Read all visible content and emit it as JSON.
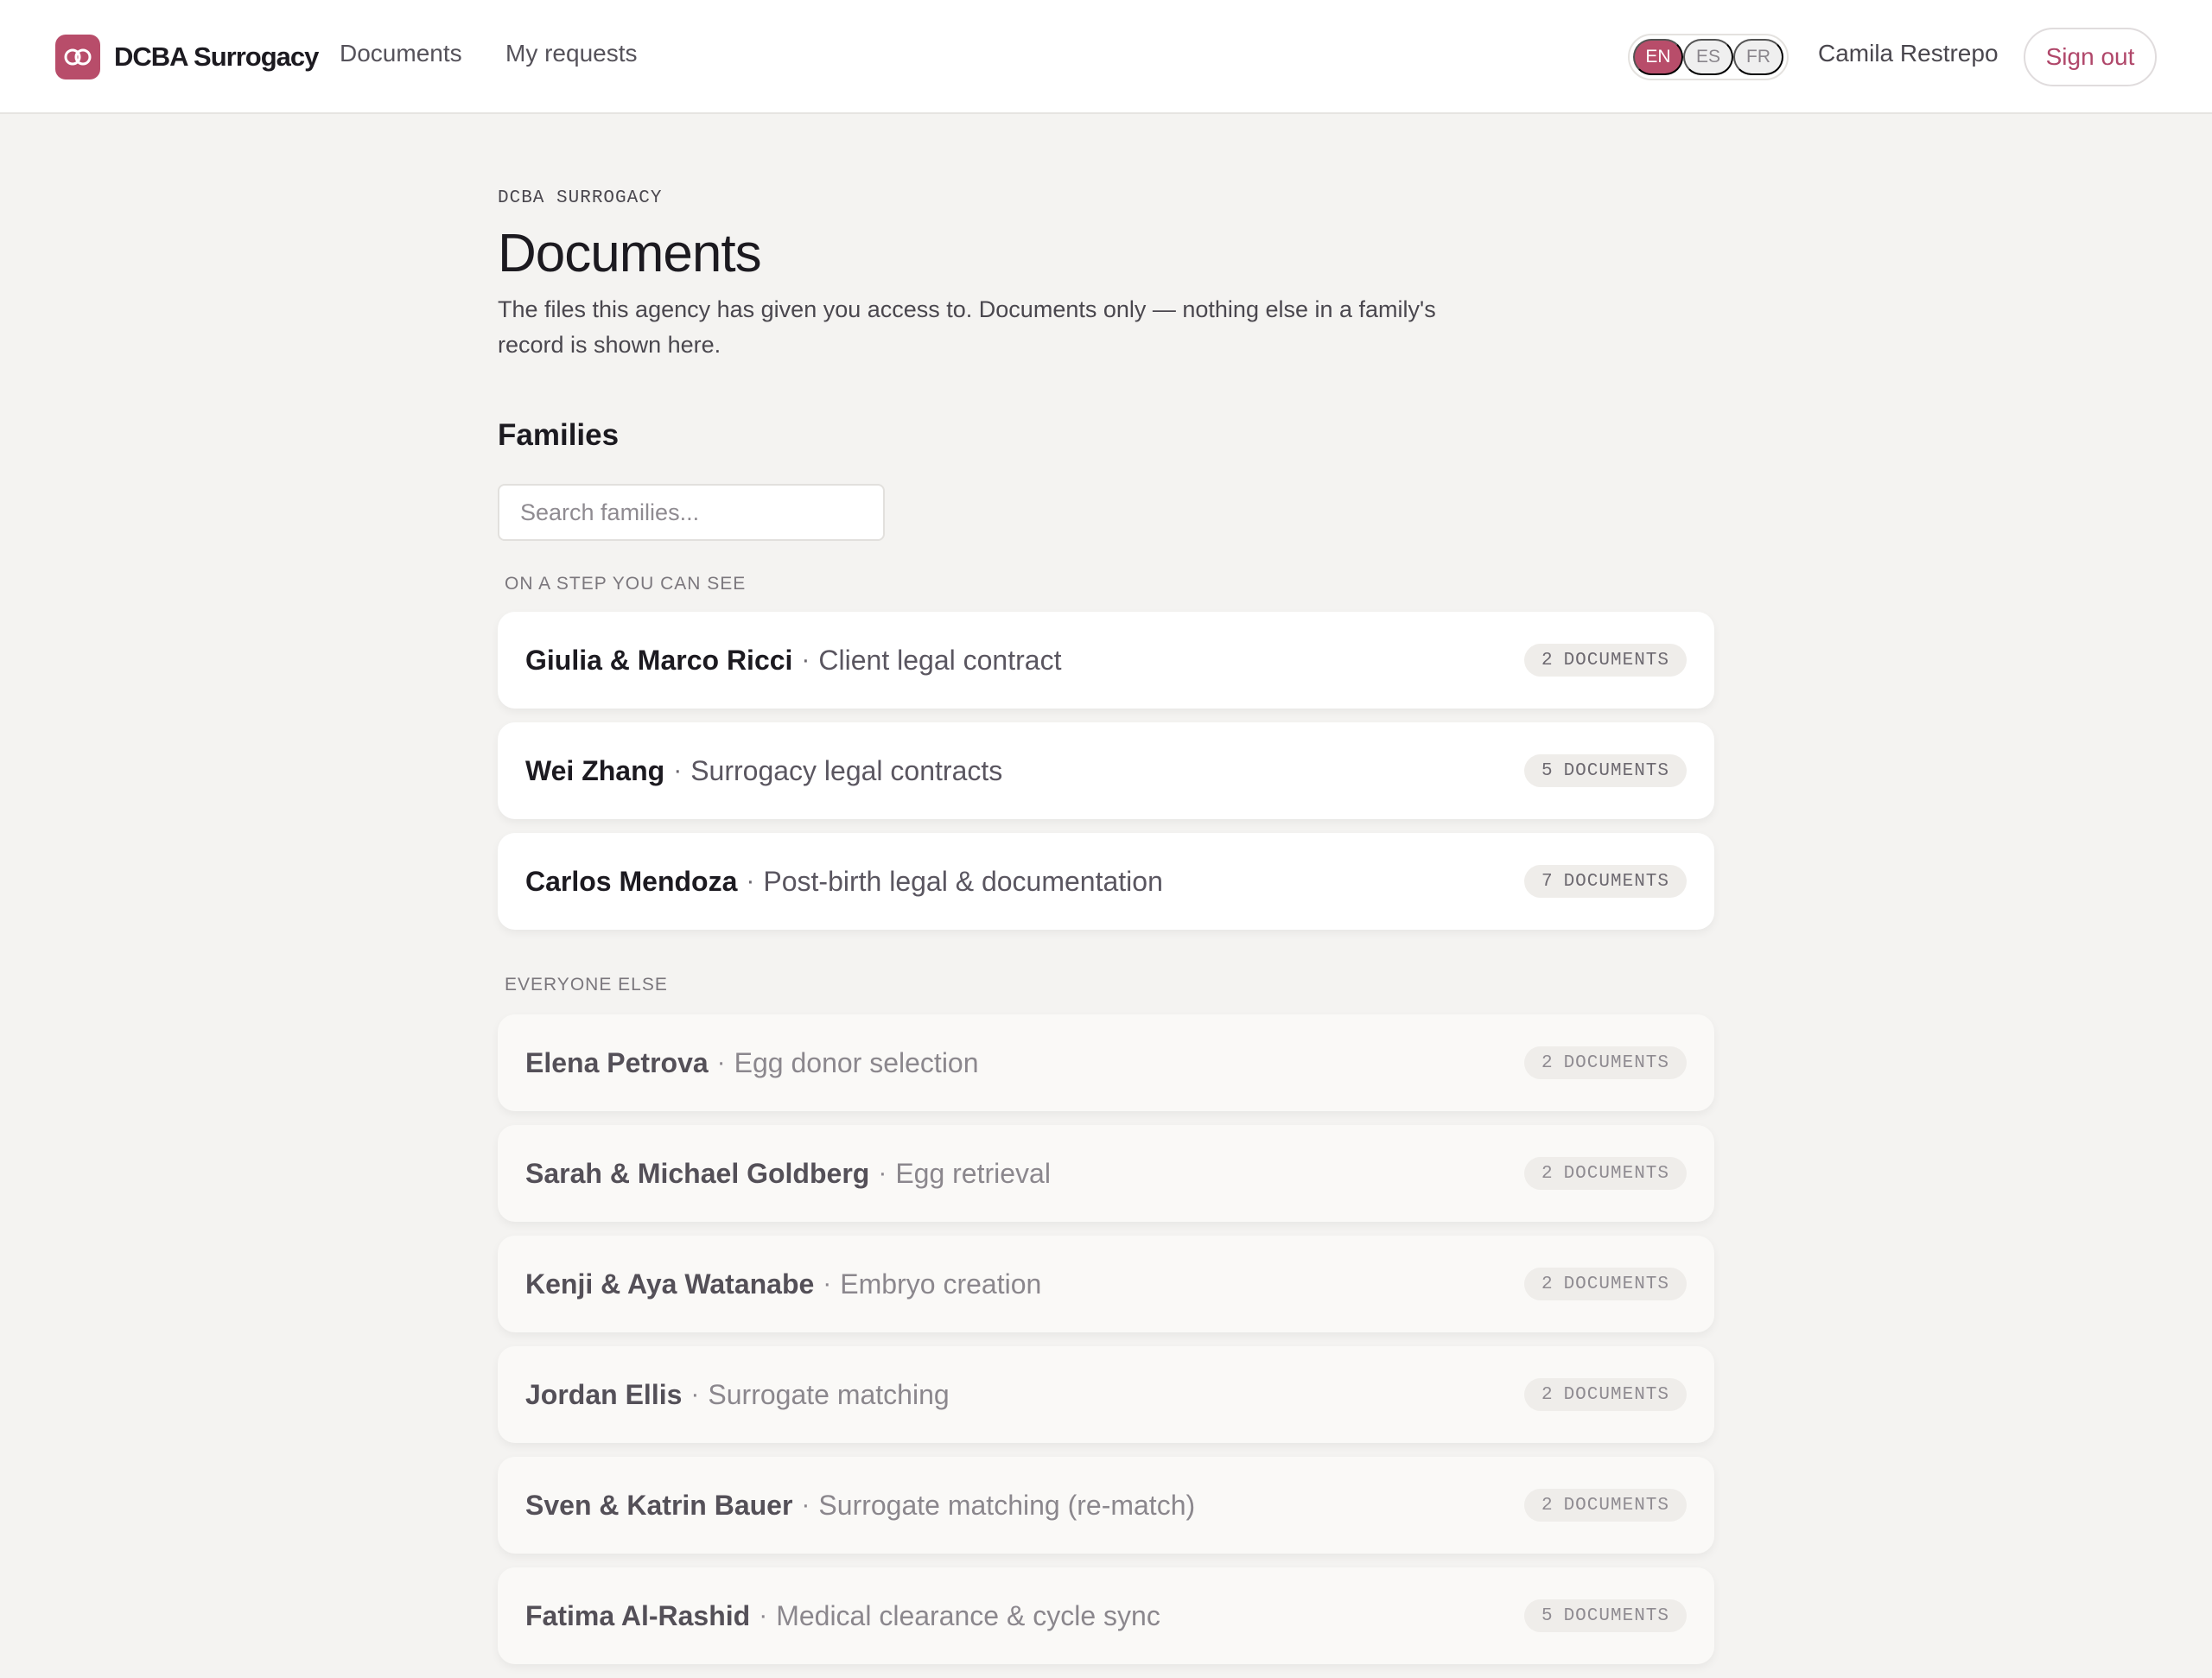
{
  "colors": {
    "accent": "#b84d6a",
    "background": "#f4f3f1",
    "card": "#ffffff",
    "card_muted": "#faf9f7"
  },
  "header": {
    "brand_name": "DCBA Surrogacy",
    "logo_icon": "interlocking-rings-icon",
    "nav": [
      {
        "label": "Documents"
      },
      {
        "label": "My requests"
      }
    ],
    "languages": [
      {
        "code": "EN",
        "active": true
      },
      {
        "code": "ES",
        "active": false
      },
      {
        "code": "FR",
        "active": false
      }
    ],
    "user_name": "Camila Restrepo",
    "sign_out": "Sign out"
  },
  "main": {
    "eyebrow": "DCBA SURROGACY",
    "title": "Documents",
    "description": "The files this agency has given you access to. Documents only — nothing else in a family's record is shown here.",
    "section_title": "Families",
    "search_placeholder": "Search families...",
    "groups": [
      {
        "label": "ON A STEP YOU CAN SEE",
        "families": [
          {
            "name": "Giulia & Marco Ricci",
            "step": "Client legal contract",
            "count": "2",
            "unit": "DOCUMENTS"
          },
          {
            "name": "Wei Zhang",
            "step": "Surrogacy legal contracts",
            "count": "5",
            "unit": "DOCUMENTS"
          },
          {
            "name": "Carlos Mendoza",
            "step": "Post-birth legal & documentation",
            "count": "7",
            "unit": "DOCUMENTS"
          }
        ]
      },
      {
        "label": "EVERYONE ELSE",
        "families": [
          {
            "name": "Elena Petrova",
            "step": "Egg donor selection",
            "count": "2",
            "unit": "DOCUMENTS"
          },
          {
            "name": "Sarah & Michael Goldberg",
            "step": "Egg retrieval",
            "count": "2",
            "unit": "DOCUMENTS"
          },
          {
            "name": "Kenji & Aya Watanabe",
            "step": "Embryo creation",
            "count": "2",
            "unit": "DOCUMENTS"
          },
          {
            "name": "Jordan Ellis",
            "step": "Surrogate matching",
            "count": "2",
            "unit": "DOCUMENTS"
          },
          {
            "name": "Sven & Katrin Bauer",
            "step": "Surrogate matching (re-match)",
            "count": "2",
            "unit": "DOCUMENTS"
          },
          {
            "name": "Fatima Al-Rashid",
            "step": "Medical clearance & cycle sync",
            "count": "5",
            "unit": "DOCUMENTS"
          }
        ]
      }
    ]
  }
}
